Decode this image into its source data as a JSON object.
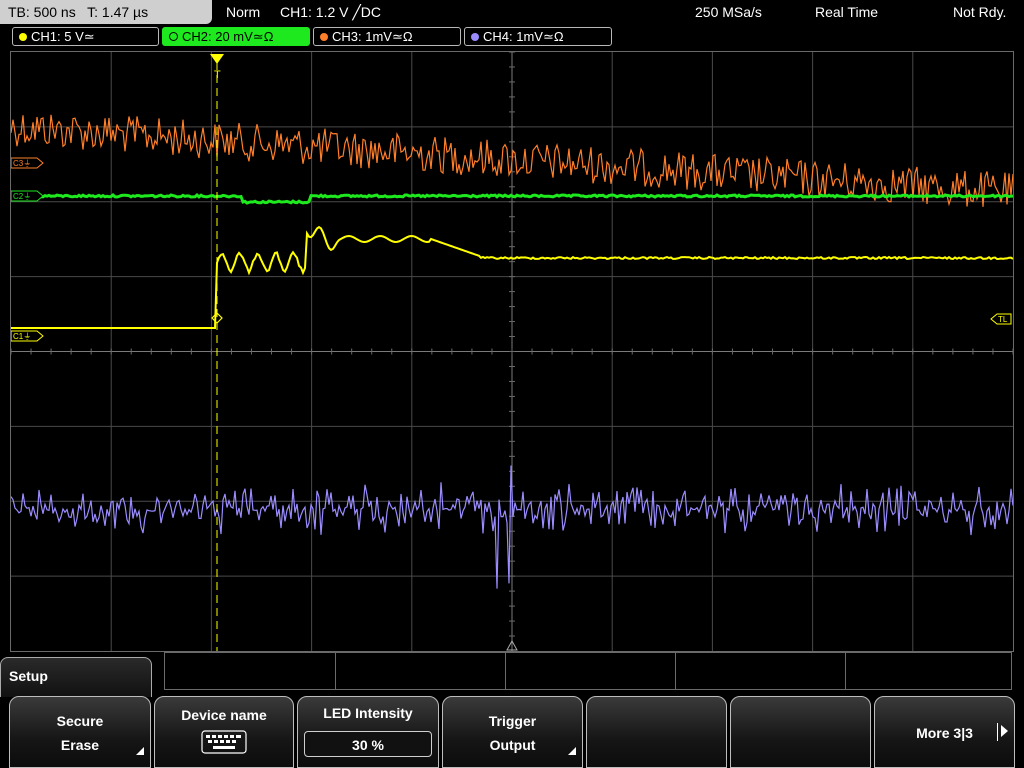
{
  "topbar": {
    "timebase": "TB: 500 ns",
    "trigger_time": "T: 1.47 µs",
    "mode": "Norm",
    "trigger_info": "CH1: 1.2 V ╱DC",
    "sample_rate": "250 MSa/s",
    "acq_mode": "Real Time",
    "status": "Not Rdy."
  },
  "channels": [
    {
      "label": "CH1: 5 V≃",
      "color": "#ffff00"
    },
    {
      "label": "CH2: 20 mV≃Ω",
      "color": "#1ee81e"
    },
    {
      "label": "CH3: 1mV≃Ω",
      "color": "#ff7f2a"
    },
    {
      "label": "CH4: 1mV≃Ω",
      "color": "#9a8cff"
    }
  ],
  "markers": {
    "c3": "C3⏚",
    "c2": "C2⏚",
    "c1": "C1⏚",
    "trigger_level": "TL",
    "trigger_pos": "T"
  },
  "setup_tab": "Setup",
  "softkeys": [
    {
      "line1": "Secure",
      "line2": "Erase"
    },
    {
      "line1": "Device name",
      "icon": "keyboard-icon"
    },
    {
      "line1": "LED Intensity",
      "value": "30 %"
    },
    {
      "line1": "Trigger",
      "line2": "Output"
    },
    {
      "line1": ""
    },
    {
      "line1": ""
    },
    {
      "line1": "More 3|3"
    }
  ],
  "colors": {
    "ch1": "#ffff00",
    "ch2": "#1ee81e",
    "ch3": "#ff7f2a",
    "ch4": "#9a8cff",
    "grid": "#5a5a5a",
    "chip_active": "#1ee81e"
  }
}
